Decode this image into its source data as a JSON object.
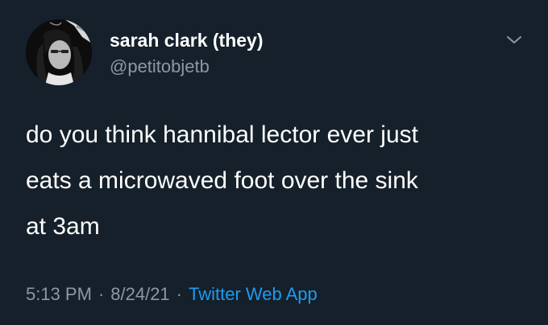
{
  "tweet": {
    "author": {
      "display_name": "sarah clark (they)",
      "handle": "@petitobjetb",
      "avatar_icon": "profile-photo"
    },
    "menu_icon": "chevron-down-icon",
    "text": "do you think hannibal lector ever just\neats a microwaved foot over the sink\nat 3am",
    "time": "5:13 PM",
    "separator": "·",
    "date": "8/24/21",
    "source": "Twitter Web App"
  },
  "colors": {
    "background": "#15202b",
    "primary_text": "#ffffff",
    "secondary_text": "#8b98a5",
    "link": "#1d9bf0"
  }
}
